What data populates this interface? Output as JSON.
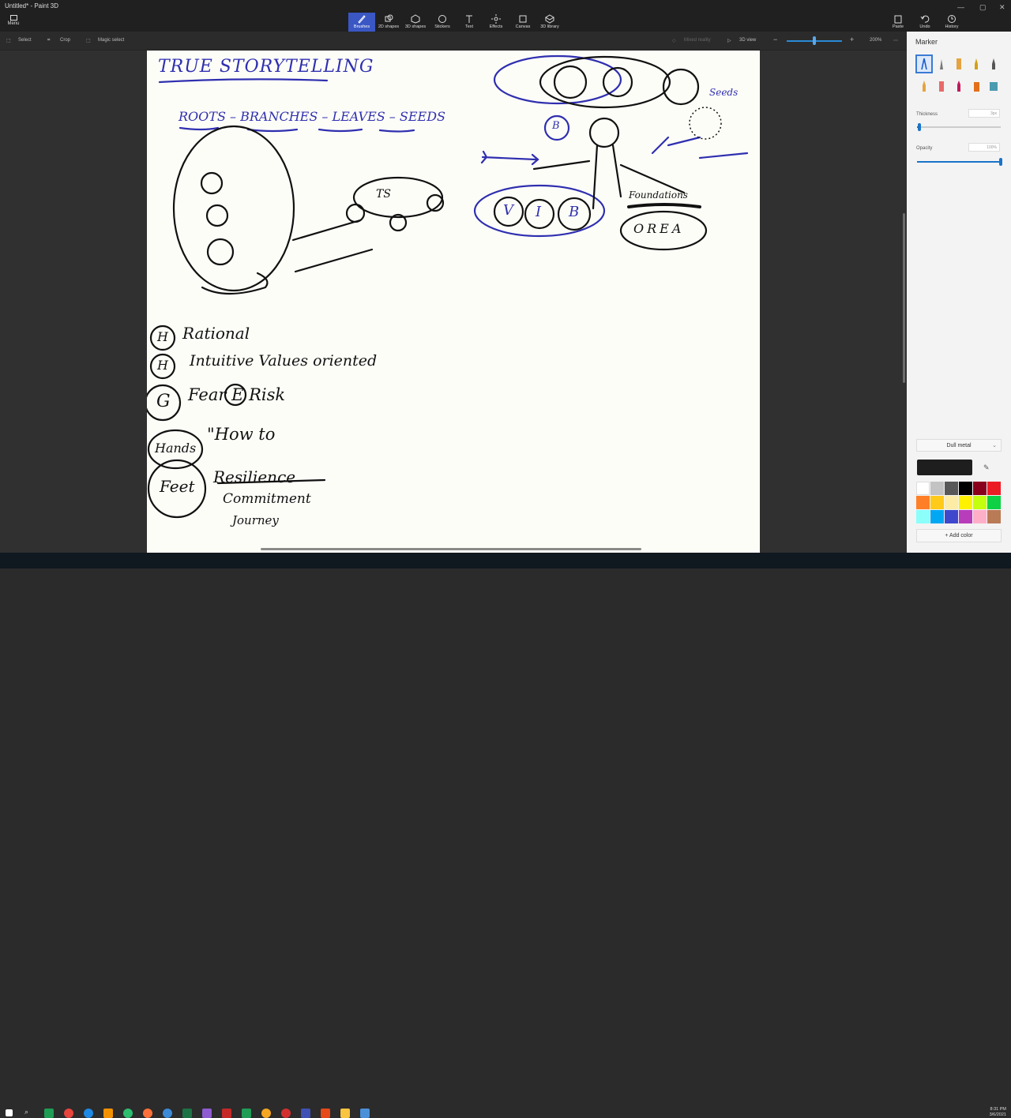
{
  "app": {
    "title": "Untitled* - Paint 3D",
    "menu_label": "Menu"
  },
  "toolbar": {
    "tools": [
      {
        "label": "Brushes",
        "icon": "brush-icon"
      },
      {
        "label": "2D shapes",
        "icon": "2d-shapes-icon"
      },
      {
        "label": "3D shapes",
        "icon": "3d-shapes-icon"
      },
      {
        "label": "Stickers",
        "icon": "stickers-icon"
      },
      {
        "label": "Text",
        "icon": "text-icon"
      },
      {
        "label": "Effects",
        "icon": "effects-icon"
      },
      {
        "label": "Canvas",
        "icon": "canvas-icon"
      },
      {
        "label": "3D library",
        "icon": "3d-library-icon"
      }
    ],
    "active_tool": "Brushes",
    "paste_label": "Paste",
    "undo_label": "Undo",
    "history_label": "History"
  },
  "subtoolbar": {
    "select_label": "Select",
    "crop_label": "Crop",
    "magic_select_label": "Magic select",
    "mixed_reality_label": "Mixed reality",
    "view3d_label": "3D view",
    "zoom_level": "200%",
    "zoom_fraction": 0.5
  },
  "canvas": {
    "title": "TRUE STORYTELLING",
    "subtitle": "ROOTS – BRANCHES – LEAVES – SEEDS",
    "notes": [
      {
        "symbol": "H",
        "text": "Rational"
      },
      {
        "symbol": "H",
        "text": "Intuitive Values oriented"
      },
      {
        "symbol": "G",
        "text": "Fear E Risk"
      },
      {
        "symbol": "Hands",
        "text": "\"How to"
      },
      {
        "symbol": "Feet",
        "text": "Resilience"
      },
      {
        "symbol": "",
        "text": "Commitment"
      },
      {
        "symbol": "",
        "text": "Journey"
      }
    ],
    "tree_labels": {
      "seeds": "Seeds",
      "foundations": "Foundations",
      "branch_circle": "B",
      "ts_bubble": "TS",
      "roots_circles": [
        "V",
        "I",
        "B"
      ],
      "base_circles": "OREA"
    }
  },
  "panel": {
    "title": "Marker",
    "thickness_label": "Thickness",
    "thickness_value": "3px",
    "thickness_fraction": 0.03,
    "opacity_label": "Opacity",
    "opacity_value": "100%",
    "opacity_fraction": 1.0,
    "finish_label": "Dull metal",
    "add_color_label": "Add color",
    "current_color": "#1e1e1e",
    "palette": [
      "#ffffff",
      "#c3c3c3",
      "#585858",
      "#000000",
      "#88001b",
      "#ec1c24",
      "#ff7f27",
      "#ffca18",
      "#fdeca6",
      "#fff200",
      "#c4ff0e",
      "#0ed145",
      "#8cfffb",
      "#00a8f3",
      "#3f48cc",
      "#b83dba",
      "#ffaec8",
      "#b97a56"
    ]
  },
  "taskbar": {
    "time": "8:31 PM",
    "date": "3/6/2021"
  }
}
